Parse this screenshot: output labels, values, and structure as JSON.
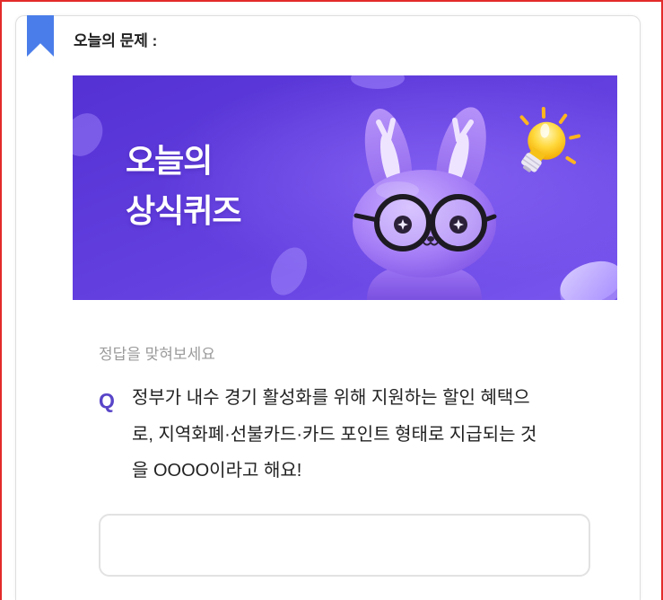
{
  "card": {
    "title": "오늘의 문제 :"
  },
  "banner": {
    "title_lines": [
      "오늘의",
      "상식퀴즈"
    ]
  },
  "quiz": {
    "instruction": "정답을 맞혀보세요",
    "marker": "Q",
    "question_lines": [
      "정부가 내수 경기 활성화를 위해 지원하는 할인 혜택으",
      "로, 지역화폐·선불카드·카드 포인트 형태로 지급되는 것",
      "을 OOOO이라고 해요!"
    ]
  },
  "answer_field": {
    "value": ""
  },
  "icons": {
    "bookmark": "bookmark-icon",
    "banner_character": "rabbit-with-glasses",
    "banner_lightbulb": "lightbulb-icon"
  },
  "colors": {
    "frame": "#e32b2b",
    "bookmark": "#4a7de9",
    "quiz_marker": "#5845c8",
    "banner_start": "#5431d3",
    "banner_end": "#7957ee"
  }
}
